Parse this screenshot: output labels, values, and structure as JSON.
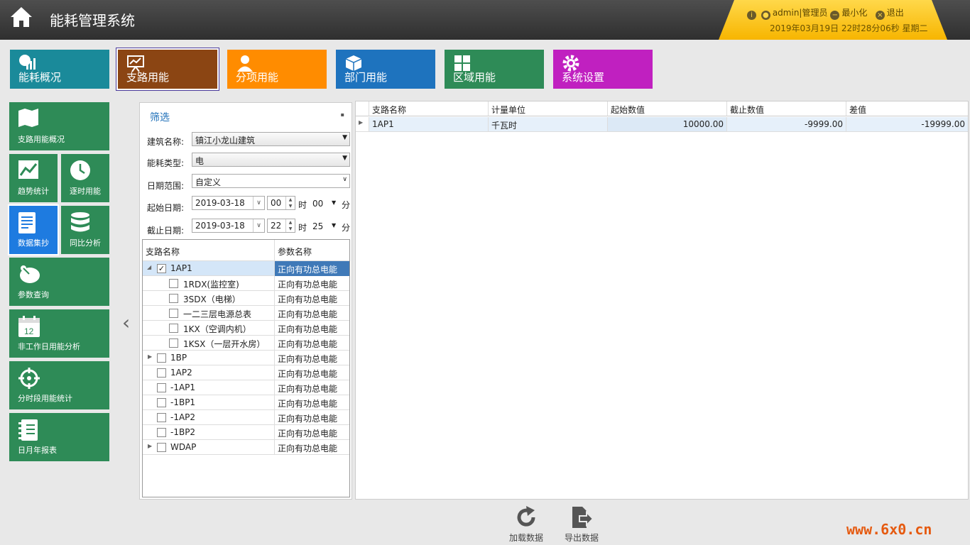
{
  "app": {
    "title": "能耗管理系统"
  },
  "header": {
    "user": "admin|管理员",
    "minimize": "最小化",
    "exit": "退出",
    "datetime": "2019年03月19日 22时28分06秒 星期二"
  },
  "nav": [
    {
      "label": "能耗概况",
      "color": "#1a8a9a"
    },
    {
      "label": "支路用能",
      "color": "#8b4513"
    },
    {
      "label": "分项用能",
      "color": "#ff8c00"
    },
    {
      "label": "部门用能",
      "color": "#1e73be"
    },
    {
      "label": "区域用能",
      "color": "#2e8b57"
    },
    {
      "label": "系统设置",
      "color": "#c020c0"
    }
  ],
  "side": [
    "支路用能概况",
    "趋势统计",
    "逐时用能",
    "数据集抄",
    "同比分析",
    "参数查询",
    "非工作日用能分析",
    "分时段用能统计",
    "日月年报表"
  ],
  "filter": {
    "title": "筛选",
    "building_label": "建筑名称:",
    "building_value": "镇江小龙山建筑",
    "energy_label": "能耗类型:",
    "energy_value": "电",
    "range_label": "日期范围:",
    "range_value": "自定义",
    "start_label": "起始日期:",
    "start_date": "2019-03-18",
    "start_hour": "00",
    "start_min": "00",
    "end_label": "截止日期:",
    "end_date": "2019-03-18",
    "end_hour": "22",
    "end_min": "25",
    "hour_unit": "时",
    "min_unit": "分"
  },
  "tree": {
    "col1": "支路名称",
    "col2": "参数名称",
    "rows": [
      {
        "name": "1AP1",
        "param": "正向有功总电能"
      },
      {
        "name": "1RDX(监控室)",
        "param": "正向有功总电能"
      },
      {
        "name": "3SDX（电梯）",
        "param": "正向有功总电能"
      },
      {
        "name": "一二三层电源总表",
        "param": "正向有功总电能"
      },
      {
        "name": "1KX（空调内机）",
        "param": "正向有功总电能"
      },
      {
        "name": "1KSX（一层开水房）",
        "param": "正向有功总电能"
      },
      {
        "name": "1BP",
        "param": "正向有功总电能"
      },
      {
        "name": "1AP2",
        "param": "正向有功总电能"
      },
      {
        "name": "-1AP1",
        "param": "正向有功总电能"
      },
      {
        "name": "-1BP1",
        "param": "正向有功总电能"
      },
      {
        "name": "-1AP2",
        "param": "正向有功总电能"
      },
      {
        "name": "-1BP2",
        "param": "正向有功总电能"
      },
      {
        "name": "WDAP",
        "param": "正向有功总电能"
      }
    ]
  },
  "grid": {
    "headers": [
      "支路名称",
      "计量单位",
      "起始数值",
      "截止数值",
      "差值"
    ],
    "row": [
      "1AP1",
      "千瓦时",
      "10000.00",
      "-9999.00",
      "-19999.00"
    ]
  },
  "actions": {
    "load": "加载数据",
    "export": "导出数据"
  },
  "watermark": "www.6x0.cn"
}
